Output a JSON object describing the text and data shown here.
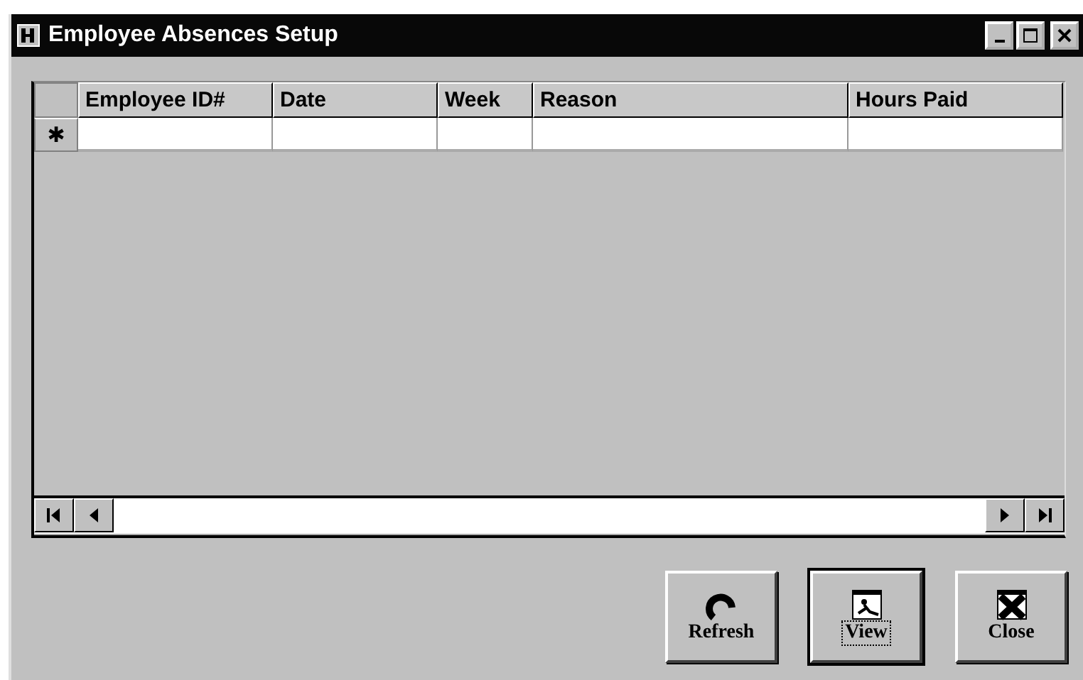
{
  "window": {
    "title": "Employee Absences Setup"
  },
  "grid": {
    "columns": [
      {
        "label": "Employee ID#"
      },
      {
        "label": "Date"
      },
      {
        "label": "Week"
      },
      {
        "label": "Reason"
      },
      {
        "label": "Hours Paid"
      }
    ],
    "new_row_marker": "✱"
  },
  "buttons": [
    {
      "label": "Refresh",
      "kind": "refresh",
      "default": false
    },
    {
      "label": "View",
      "kind": "view",
      "default": true
    },
    {
      "label": "Close",
      "kind": "close",
      "default": false
    }
  ]
}
